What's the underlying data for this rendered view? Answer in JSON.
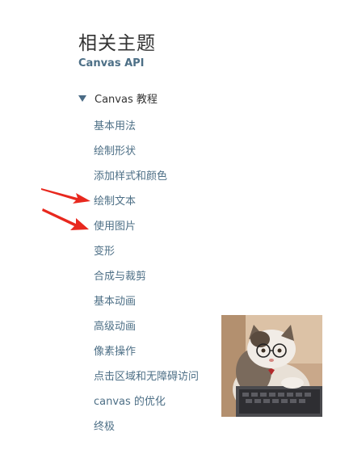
{
  "related": {
    "heading": "相关主题",
    "api_link": "Canvas API"
  },
  "tutorial": {
    "section_label": "Canvas 教程",
    "items": [
      {
        "label": "基本用法"
      },
      {
        "label": "绘制形状"
      },
      {
        "label": "添加样式和颜色"
      },
      {
        "label": "绘制文本"
      },
      {
        "label": "使用图片"
      },
      {
        "label": "变形"
      },
      {
        "label": "合成与裁剪"
      },
      {
        "label": "基本动画"
      },
      {
        "label": "高级动画"
      },
      {
        "label": "像素操作"
      },
      {
        "label": "点击区域和无障碍访问"
      },
      {
        "label": "canvas 的优化"
      },
      {
        "label": "终极"
      }
    ]
  },
  "colors": {
    "link": "#4d6f86",
    "heading": "#333333",
    "arrow": "#e8281e"
  },
  "icons": {
    "expand": "triangle-down-icon",
    "annotation": "red-arrow-icon"
  }
}
